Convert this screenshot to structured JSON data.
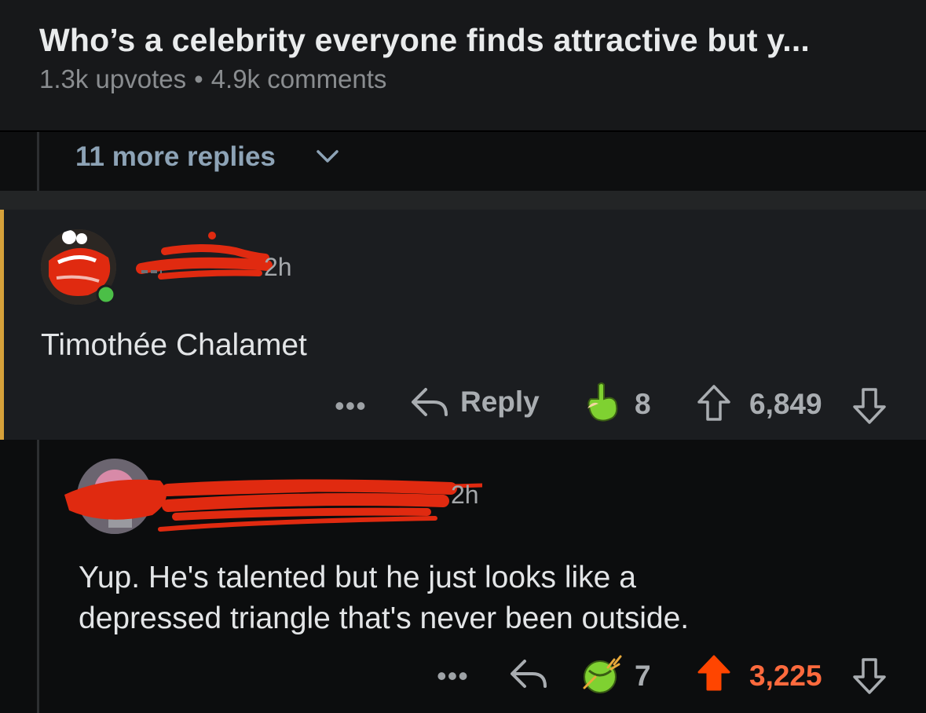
{
  "post": {
    "title": "Who’s a celebrity everyone finds attractive but y...",
    "upvotes": "1.3k upvotes",
    "separator": "•",
    "comments": "4.9k comments"
  },
  "thread": {
    "more_replies_label": "11 more replies"
  },
  "comment1": {
    "age": "2h",
    "body": "Timothée Chalamet",
    "more_label": "•••",
    "reply_label": "Reply",
    "award_count": "8",
    "score": "6,849"
  },
  "comment2": {
    "age": "2h",
    "body_line1": "Yup. He's talented but he just looks like a",
    "body_line2": "depressed triangle that's never been outside.",
    "more_label": "•••",
    "award_count": "7",
    "score": "3,225"
  },
  "colors": {
    "highlight": "#d6a13a",
    "upvoted": "#ff4500",
    "redaction": "#e02a10",
    "award": "#7fd131"
  }
}
